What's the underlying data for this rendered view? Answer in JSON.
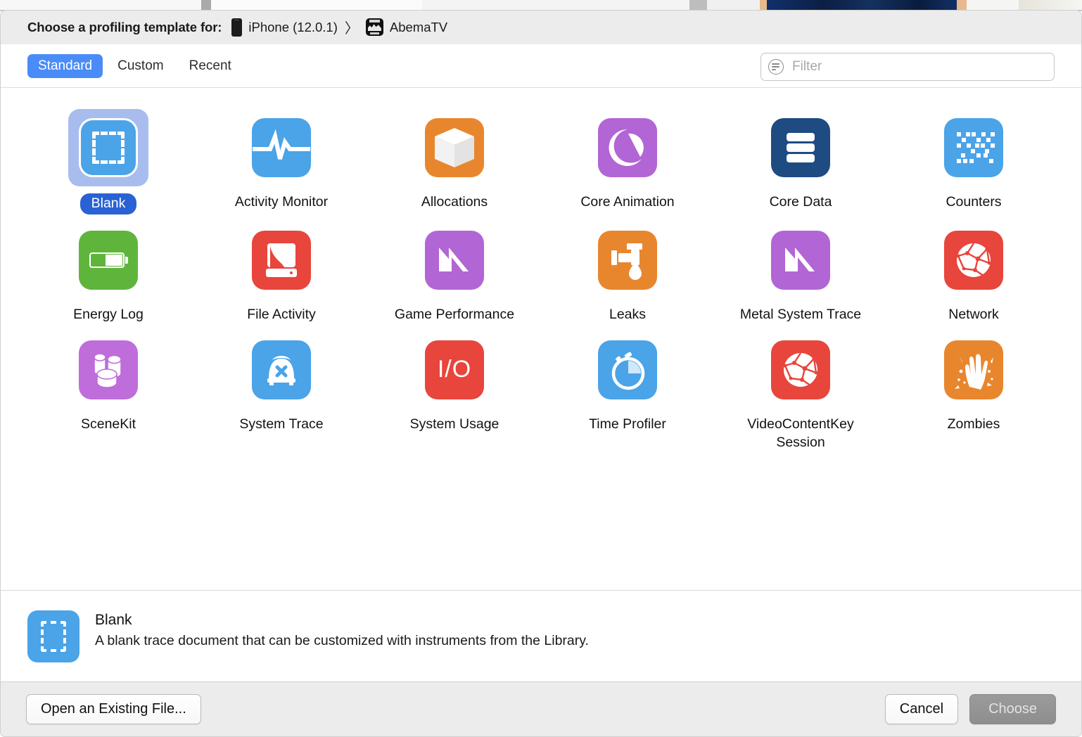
{
  "header": {
    "title": "Choose a profiling template for:",
    "device_icon": "iphone-icon",
    "device": "iPhone (12.0.1)",
    "separator": "〉",
    "app_icon": "abematv-app-icon",
    "app": "AbemaTV"
  },
  "tabs": [
    {
      "label": "Standard",
      "active": true
    },
    {
      "label": "Custom",
      "active": false
    },
    {
      "label": "Recent",
      "active": false
    }
  ],
  "search": {
    "placeholder": "Filter",
    "value": "",
    "icon": "filter-icon"
  },
  "templates": [
    {
      "label": "Blank",
      "icon": "blank-icon",
      "color": "#4ba3e8",
      "selected": true
    },
    {
      "label": "Activity Monitor",
      "icon": "ekg-waveform-icon",
      "color": "#4ba3e8",
      "selected": false
    },
    {
      "label": "Allocations",
      "icon": "cube-icon",
      "color": "#e8862e",
      "selected": false
    },
    {
      "label": "Core Animation",
      "icon": "crescent-icon",
      "color": "#b265d4",
      "selected": false
    },
    {
      "label": "Core Data",
      "icon": "database-bars-icon",
      "color": "#1e4b82",
      "selected": false
    },
    {
      "label": "Counters",
      "icon": "pixel-scatter-icon",
      "color": "#4ba3e8",
      "selected": false
    },
    {
      "label": "Energy Log",
      "icon": "battery-icon",
      "color": "#5fb53c",
      "selected": false
    },
    {
      "label": "File Activity",
      "icon": "file-page-icon",
      "color": "#e8453c",
      "selected": false
    },
    {
      "label": "Game Performance",
      "icon": "metal-m-icon",
      "color": "#b265d4",
      "selected": false
    },
    {
      "label": "Leaks",
      "icon": "faucet-drip-icon",
      "color": "#e8862e",
      "selected": false
    },
    {
      "label": "Metal System Trace",
      "icon": "metal-m-icon",
      "color": "#b265d4",
      "selected": false
    },
    {
      "label": "Network",
      "icon": "network-globe-icon",
      "color": "#e8453c",
      "selected": false
    },
    {
      "label": "SceneKit",
      "icon": "cylinders-icon",
      "color": "#bf6ddb",
      "selected": false
    },
    {
      "label": "System Trace",
      "icon": "phone-x-icon",
      "color": "#4ba3e8",
      "selected": false
    },
    {
      "label": "System Usage",
      "icon": "io-text-icon",
      "color": "#e8453c",
      "selected": false
    },
    {
      "label": "Time Profiler",
      "icon": "stopwatch-icon",
      "color": "#4ba3e8",
      "selected": false
    },
    {
      "label": "VideoContentKey Session",
      "icon": "network-globe-icon",
      "color": "#e8453c",
      "selected": false
    },
    {
      "label": "Zombies",
      "icon": "zombie-hand-icon",
      "color": "#e8862e",
      "selected": false
    }
  ],
  "detail": {
    "icon": "blank-icon",
    "title": "Blank",
    "description": "A blank trace document that can be customized with instruments from the Library."
  },
  "footer": {
    "open_existing": "Open an Existing File...",
    "cancel": "Cancel",
    "choose": "Choose",
    "choose_enabled": false
  },
  "io_label": "I/O",
  "accent_color": "#4a8cf7",
  "selected_pill_color": "#2a62d4"
}
